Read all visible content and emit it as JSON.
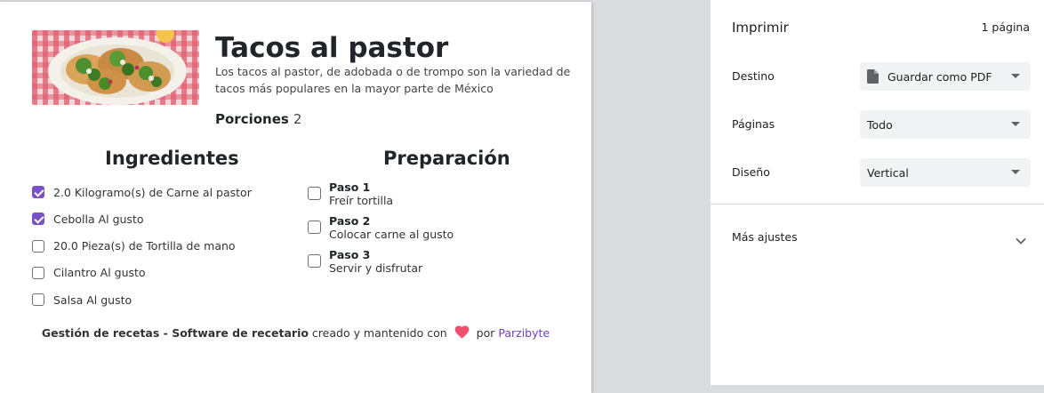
{
  "recipe": {
    "title": "Tacos al pastor",
    "description": "Los tacos al pastor, de adobada o de trompo son la variedad de tacos más populares en la mayor parte de México",
    "portions_label": "Porciones",
    "portions_value": "2",
    "ingredients_title": "Ingredientes",
    "preparation_title": "Preparación",
    "ingredients": [
      {
        "text": "2.0 Kilogramo(s) de Carne al pastor",
        "checked": true
      },
      {
        "text": "Cebolla Al gusto",
        "checked": true
      },
      {
        "text": "20.0 Pieza(s) de Tortilla de mano",
        "checked": false
      },
      {
        "text": "Cilantro Al gusto",
        "checked": false
      },
      {
        "text": "Salsa Al gusto",
        "checked": false
      }
    ],
    "steps": [
      {
        "title": "Paso 1",
        "desc": "Freír tortilla",
        "checked": false
      },
      {
        "title": "Paso 2",
        "desc": "Colocar carne al gusto",
        "checked": false
      },
      {
        "title": "Paso 3",
        "desc": "Servir y disfrutar",
        "checked": false
      }
    ],
    "footer": {
      "bold": "Gestión de recetas - Software de recetario",
      "middle": "creado y mantenido con",
      "by": "por",
      "link": "Parzibyte"
    }
  },
  "print": {
    "title": "Imprimir",
    "page_count": "1 página",
    "destination_label": "Destino",
    "destination_value": "Guardar como PDF",
    "pages_label": "Páginas",
    "pages_value": "Todo",
    "layout_label": "Diseño",
    "layout_value": "Vertical",
    "more_settings": "Más ajustes"
  },
  "colors": {
    "accent": "#7a52c7",
    "heart": "#f0506e",
    "link": "#6f42c1"
  }
}
